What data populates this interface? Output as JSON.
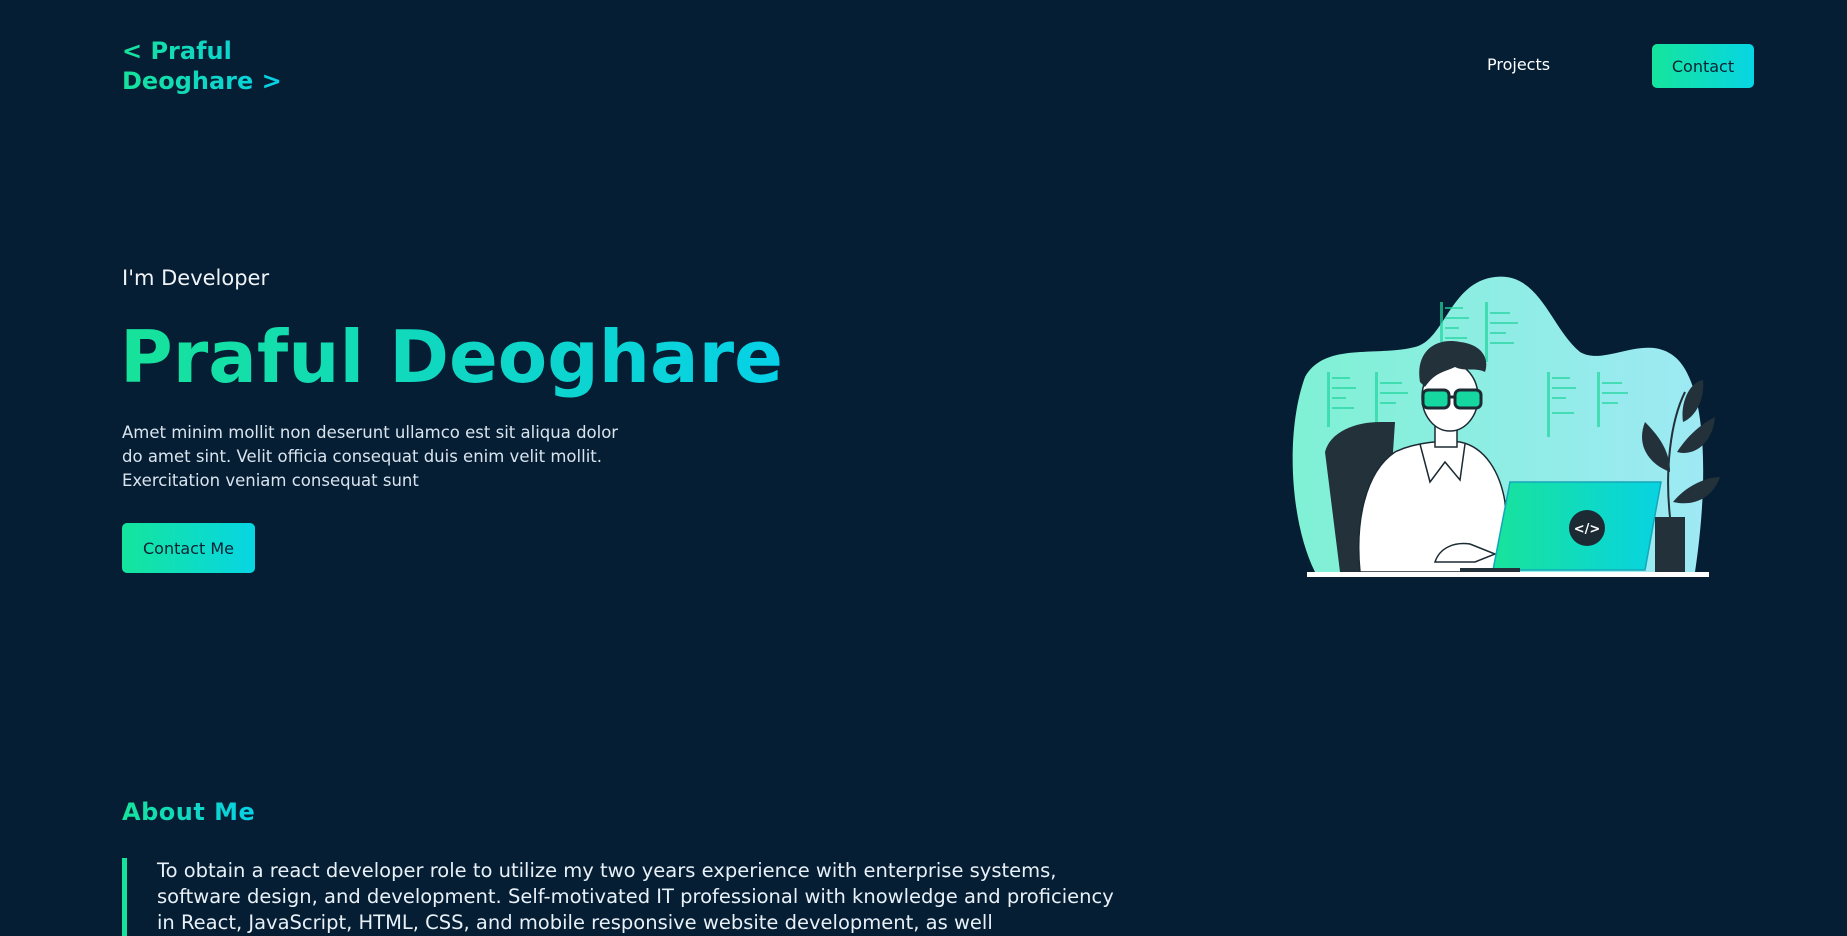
{
  "header": {
    "logo_line1": "< Praful",
    "logo_line2": "Deoghare >",
    "nav_projects": "Projects",
    "nav_contact": "Contact"
  },
  "hero": {
    "subtitle": "I'm Developer",
    "name": "Praful Deoghare",
    "description": "Amet minim mollit non deserunt ullamco est sit aliqua dolor do amet sint. Velit officia consequat duis enim velit mollit. Exercitation veniam consequat sunt",
    "cta_label": "Contact Me",
    "illustration_code_glyph": "</>",
    "illustration_icon": "developer-at-laptop-illustration"
  },
  "about": {
    "title": "About Me",
    "body": "To obtain a react developer role to utilize my two years experience with enterprise systems, software design, and development. Self-motivated IT professional with knowledge and proficiency in React, JavaScript, HTML, CSS, and mobile responsive website development, as well"
  },
  "colors": {
    "background": "#051e33",
    "accent_start": "#15e59c",
    "accent_end": "#07d5e4",
    "text": "#e6f1ff"
  }
}
